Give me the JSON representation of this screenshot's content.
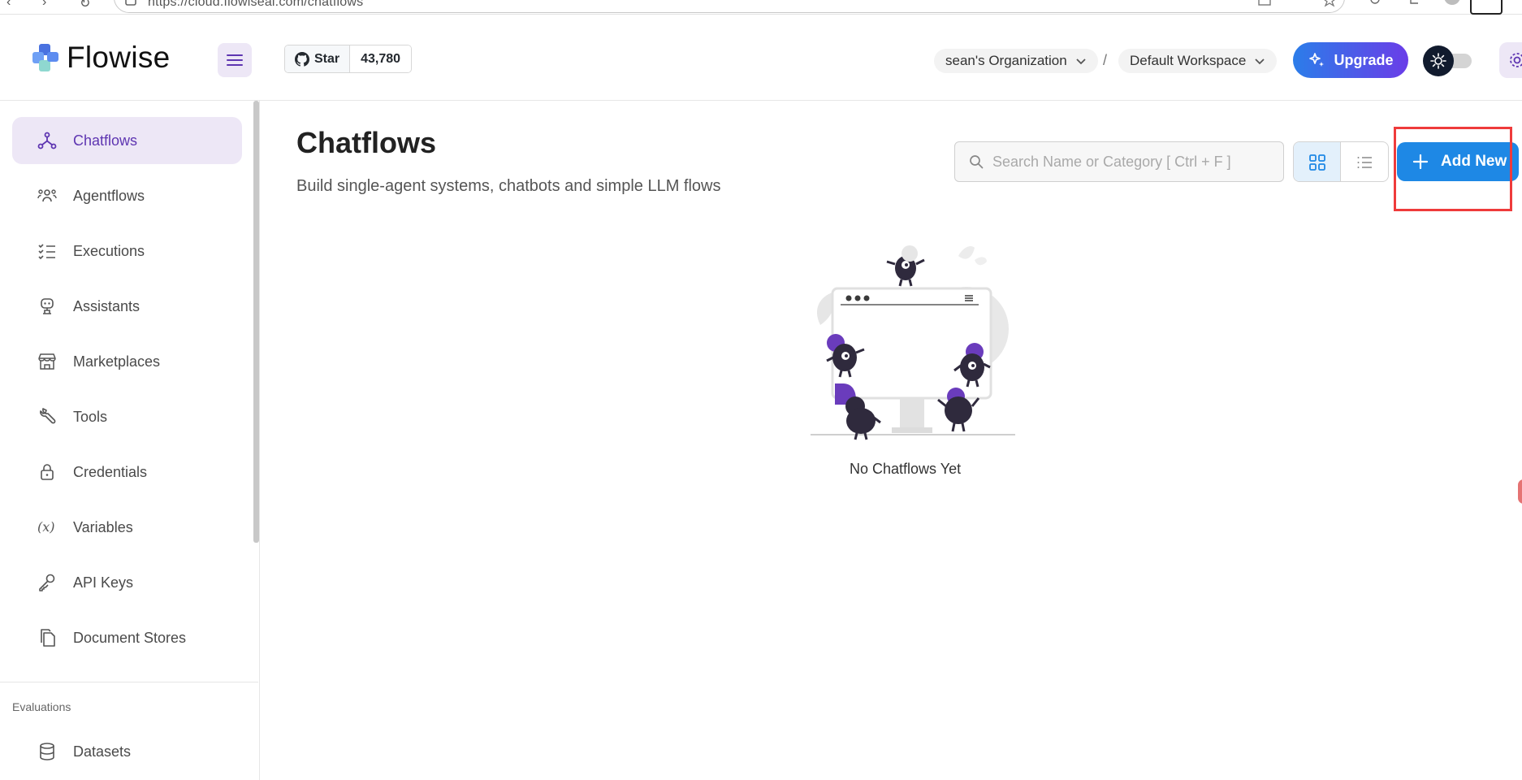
{
  "browser": {
    "url": "https://cloud.flowiseai.com/chatflows"
  },
  "header": {
    "brand": "Flowise",
    "github": {
      "star_label": "Star",
      "count": "43,780"
    },
    "organization": "sean's Organization",
    "separator": "/",
    "workspace": "Default Workspace",
    "upgrade_label": "Upgrade"
  },
  "sidebar": {
    "items": [
      {
        "label": "Chatflows",
        "icon": "hierarchy-icon",
        "active": true
      },
      {
        "label": "Agentflows",
        "icon": "users-group-icon"
      },
      {
        "label": "Executions",
        "icon": "checklist-icon"
      },
      {
        "label": "Assistants",
        "icon": "robot-icon"
      },
      {
        "label": "Marketplaces",
        "icon": "building-store-icon"
      },
      {
        "label": "Tools",
        "icon": "tool-icon"
      },
      {
        "label": "Credentials",
        "icon": "lock-icon"
      },
      {
        "label": "Variables",
        "icon": "variable-icon"
      },
      {
        "label": "API Keys",
        "icon": "key-icon"
      },
      {
        "label": "Document Stores",
        "icon": "files-icon"
      }
    ],
    "section_label": "Evaluations",
    "section_items": [
      {
        "label": "Datasets",
        "icon": "database-icon"
      }
    ]
  },
  "main": {
    "title": "Chatflows",
    "subtitle": "Build single-agent systems, chatbots and simple LLM flows",
    "search_placeholder": "Search Name or Category [ Ctrl + F ]",
    "add_new_label": "Add New",
    "empty_text": "No Chatflows Yet"
  },
  "colors": {
    "accent_purple": "#5e35b1",
    "active_bg": "#ede7f6",
    "primary_blue": "#1e88e5",
    "highlight_red": "#ef3b3b"
  }
}
